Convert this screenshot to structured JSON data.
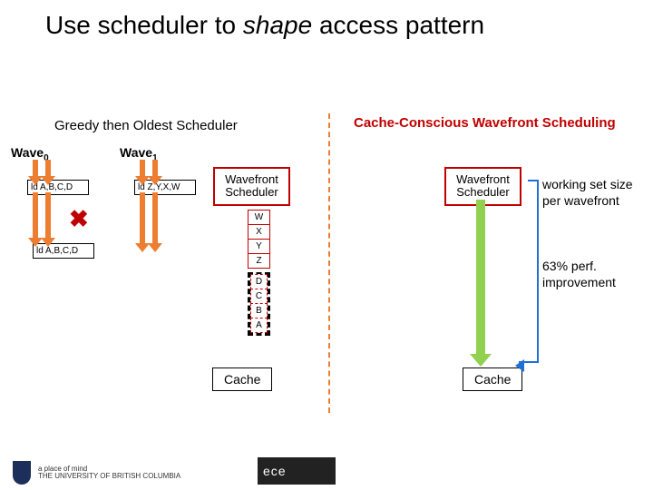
{
  "title_prefix": "Use scheduler to ",
  "title_emph": "shape",
  "title_suffix": " access pattern",
  "left_heading": "Greedy then Oldest Scheduler",
  "right_heading": "Cache-Conscious Wavefront Scheduling",
  "wave0": "Wave",
  "wave0_sub": "0",
  "wave1": "Wave",
  "wave1_sub": "1",
  "ld_abcd": "ld A,B,C,D",
  "ld_zyxw": "ld Z,Y,X,W",
  "ws_label": "Wavefront Scheduler",
  "stack_wxyz": [
    "W",
    "X",
    "Y",
    "Z"
  ],
  "stack_dcba": [
    "D",
    "C",
    "B",
    "A"
  ],
  "cache_label": "Cache",
  "note_workingset": "working set size per wavefront",
  "note_improvement": "63% perf. improvement",
  "footer_line1": "a place of mind",
  "footer_line2": "THE UNIVERSITY OF BRITISH COLUMBIA",
  "ece": "ece"
}
